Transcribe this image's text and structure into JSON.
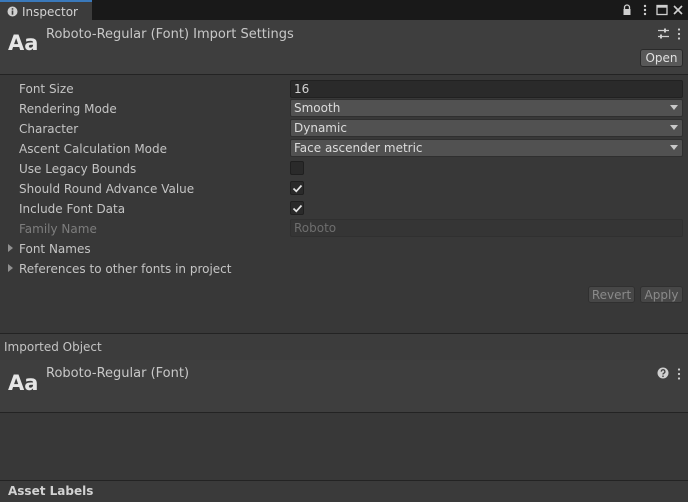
{
  "tab": {
    "label": "Inspector"
  },
  "header": {
    "icon_text": "Aa",
    "title": "Roboto-Regular (Font) Import Settings",
    "open_button": "Open"
  },
  "properties": {
    "font_size": {
      "label": "Font Size",
      "value": "16"
    },
    "rendering_mode": {
      "label": "Rendering Mode",
      "value": "Smooth"
    },
    "character": {
      "label": "Character",
      "value": "Dynamic"
    },
    "ascent_mode": {
      "label": "Ascent Calculation Mode",
      "value": "Face ascender metric"
    },
    "legacy_bounds": {
      "label": "Use Legacy Bounds",
      "checked": false
    },
    "round_advance": {
      "label": "Should Round Advance Value",
      "checked": true
    },
    "include_font_data": {
      "label": "Include Font Data",
      "checked": true
    },
    "family_name": {
      "label": "Family Name",
      "value": "Roboto"
    },
    "font_names": {
      "label": "Font Names"
    },
    "references": {
      "label": "References to other fonts in project"
    }
  },
  "buttons": {
    "revert": "Revert",
    "apply": "Apply"
  },
  "imported_object": {
    "section_label": "Imported Object",
    "icon_text": "Aa",
    "title": "Roboto-Regular (Font)"
  },
  "asset_labels": {
    "label": "Asset Labels"
  },
  "icons": [
    "info-icon",
    "lock-icon",
    "menu-dots-icon",
    "maximize-icon",
    "close-icon",
    "preset-sliders-icon",
    "help-icon",
    "checkmark-icon",
    "foldout-arrow-icon",
    "dropdown-arrow-icon"
  ]
}
